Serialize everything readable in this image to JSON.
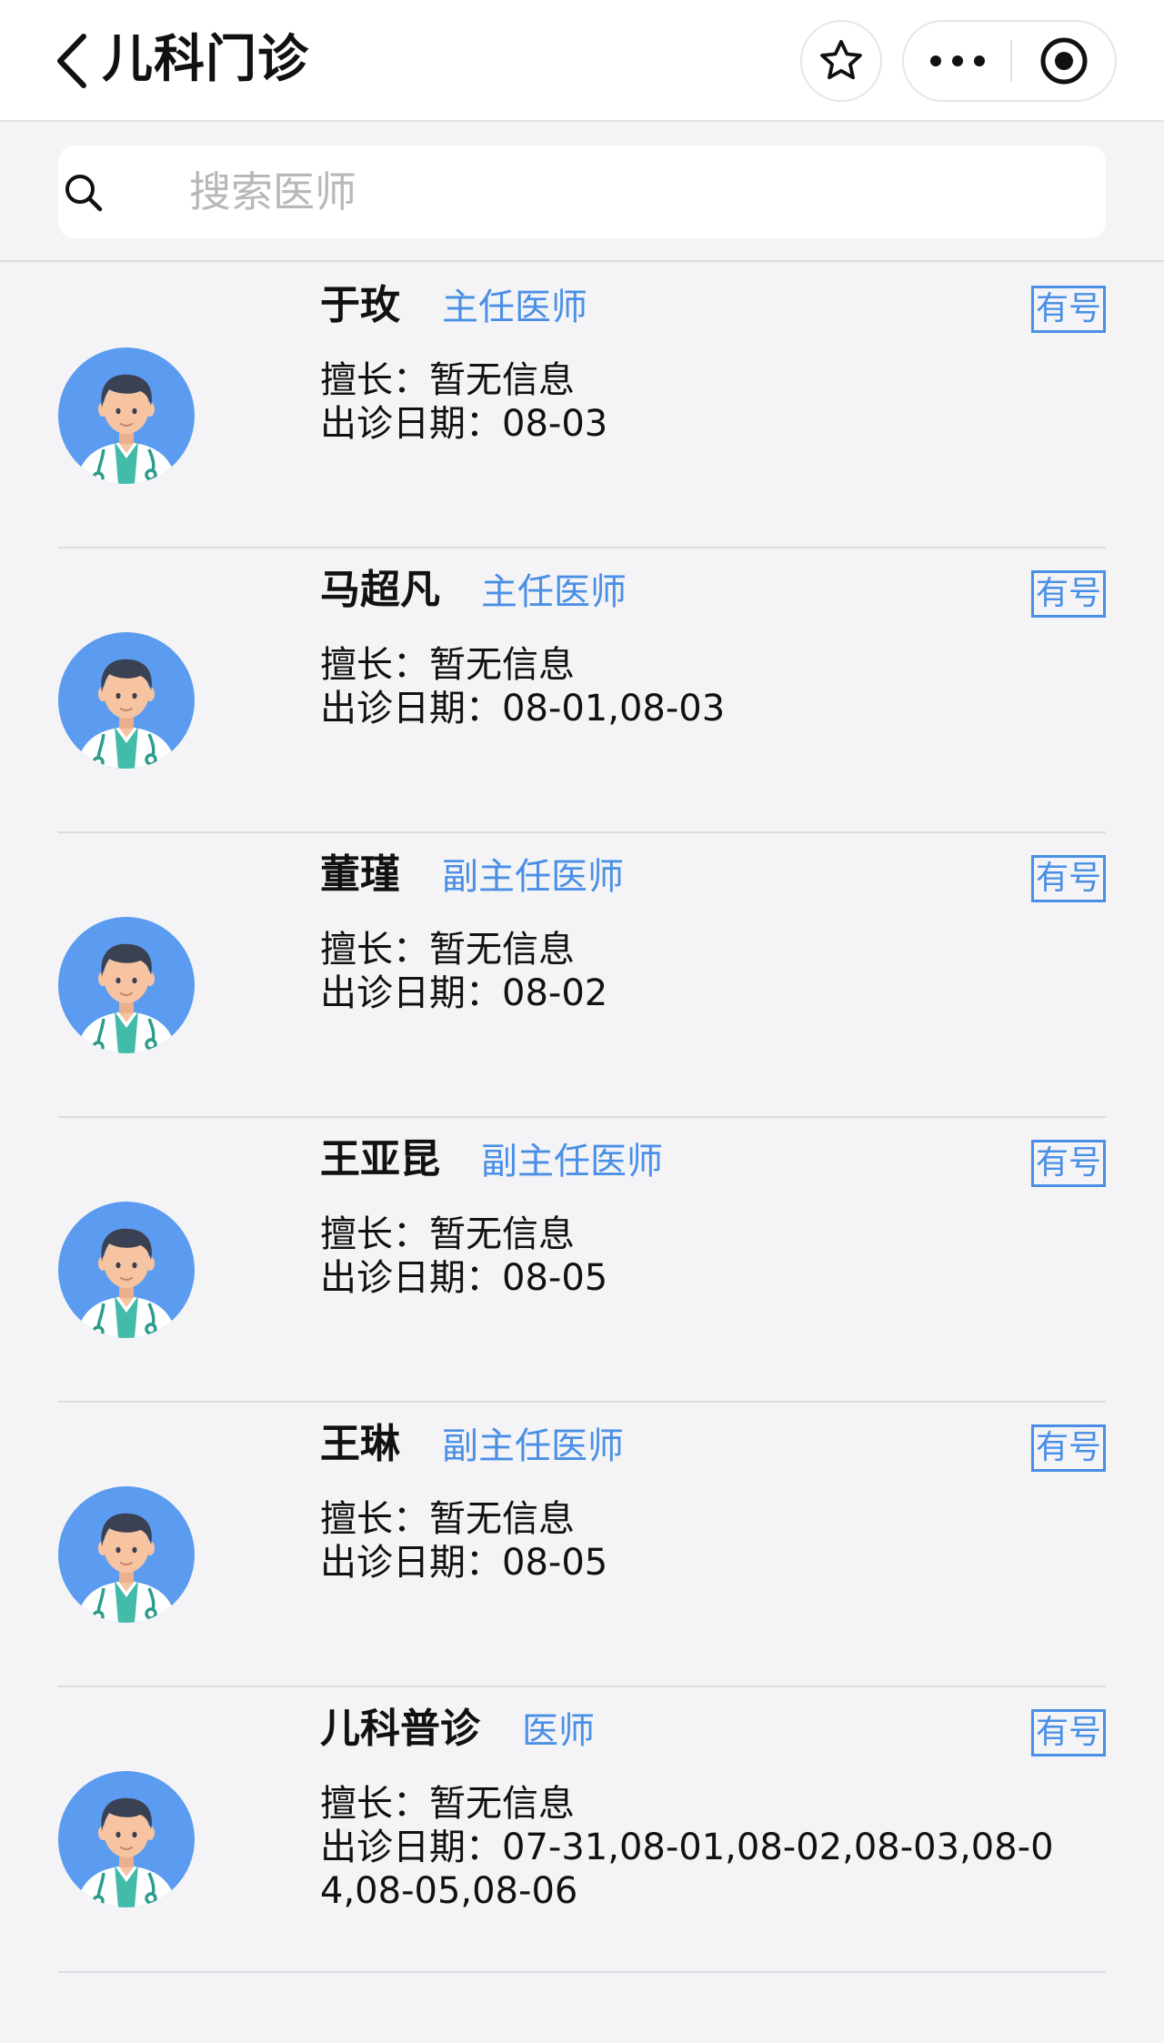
{
  "header": {
    "title": "儿科门诊",
    "icons": {
      "back": "chevron-left-icon",
      "favorite": "star-icon",
      "more": "more-dots-icon",
      "record": "record-circle-icon"
    }
  },
  "search": {
    "placeholder": "搜索医师",
    "value": "",
    "icon": "search-icon"
  },
  "labels": {
    "skill_prefix": "擅长：",
    "dates_prefix": "出诊日期："
  },
  "colors": {
    "accent": "#4a8fe6",
    "avatar_bg": "#5b9bf0",
    "page_bg": "#f4f4f6"
  },
  "doctors": [
    {
      "name": "于玫",
      "title": "主任医师",
      "badge": "有号",
      "skill": "暂无信息",
      "dates": "08-03"
    },
    {
      "name": "马超凡",
      "title": "主任医师",
      "badge": "有号",
      "skill": "暂无信息",
      "dates": "08-01,08-03"
    },
    {
      "name": "董瑾",
      "title": "副主任医师",
      "badge": "有号",
      "skill": "暂无信息",
      "dates": "08-02"
    },
    {
      "name": "王亚昆",
      "title": "副主任医师",
      "badge": "有号",
      "skill": "暂无信息",
      "dates": "08-05"
    },
    {
      "name": "王琳",
      "title": "副主任医师",
      "badge": "有号",
      "skill": "暂无信息",
      "dates": "08-05"
    },
    {
      "name": "儿科普诊",
      "title": "医师",
      "badge": "有号",
      "skill": "暂无信息",
      "dates": "07-31,08-01,08-02,08-03,08-04,08-05,08-06"
    }
  ]
}
